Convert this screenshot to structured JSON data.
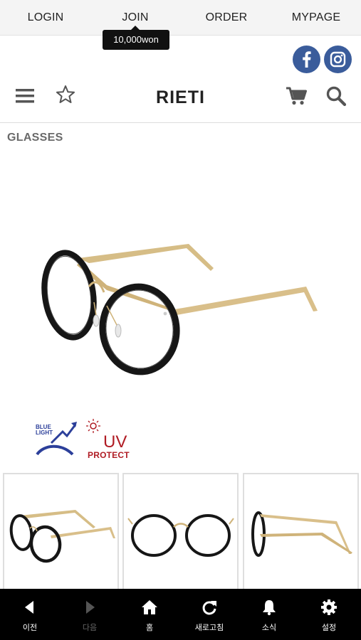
{
  "topnav": {
    "login": "LOGIN",
    "join": "JOIN",
    "order": "ORDER",
    "mypage": "MYPAGE",
    "join_tooltip": "10,000won"
  },
  "social": {
    "facebook_icon": "facebook-icon",
    "instagram_icon": "instagram-icon",
    "color": "#3a5c9b"
  },
  "header": {
    "brand": "RIETI",
    "icons": [
      "menu-icon",
      "star-icon",
      "cart-icon",
      "search-icon"
    ]
  },
  "category": "GLASSES",
  "badges": {
    "blue_light": "BLUE LIGHT",
    "uv": "UV",
    "uv_protect": "PROTECT"
  },
  "thumbnails": [
    "glasses-angle-view",
    "glasses-front-view",
    "glasses-side-view"
  ],
  "bottombar": {
    "items": [
      {
        "label": "이전",
        "icon": "back-icon"
      },
      {
        "label": "다음",
        "icon": "forward-icon"
      },
      {
        "label": "홈",
        "icon": "home-icon"
      },
      {
        "label": "새로고침",
        "icon": "refresh-icon"
      },
      {
        "label": "소식",
        "icon": "bell-icon"
      },
      {
        "label": "설정",
        "icon": "gear-icon"
      }
    ]
  }
}
